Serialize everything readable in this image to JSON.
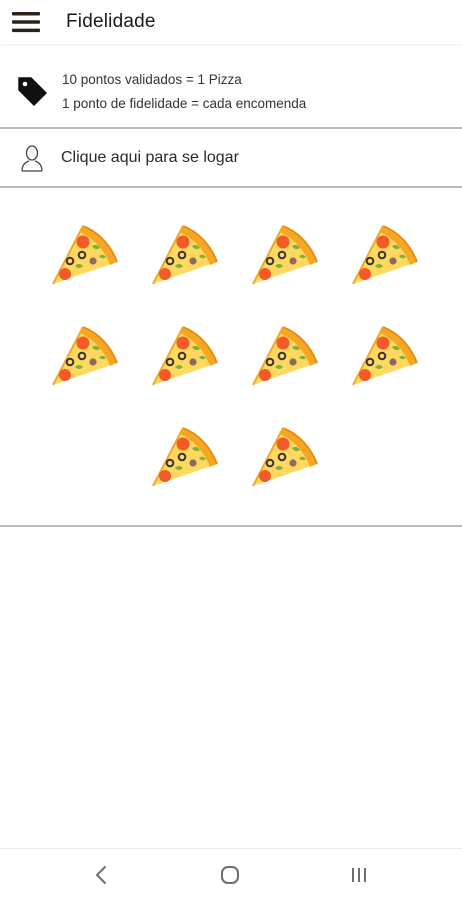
{
  "appbar": {
    "title": "Fidelidade",
    "menu_icon": "hamburger-menu-icon"
  },
  "info": {
    "icon": "price-tag-icon",
    "line1": "10 pontos validados = 1 Pizza",
    "line2": "1 ponto de fidelidade = cada encomenda"
  },
  "login": {
    "icon": "user-icon",
    "label": "Clique aqui para se logar"
  },
  "stamps": {
    "icon": "pizza-slice-icon",
    "count": 10,
    "per_row": 4
  },
  "navbar": {
    "back_icon": "back-chevron-icon",
    "home_icon": "home-circle-icon",
    "recents_icon": "recents-icon"
  },
  "colors": {
    "crust": "#F5A623",
    "crust_dark": "#E0901A",
    "cheese": "#FFD860",
    "pepperoni": "#F25A2A",
    "olive": "#333333",
    "leaf": "#7FB03A",
    "mushroom": "#8C6B5A"
  }
}
